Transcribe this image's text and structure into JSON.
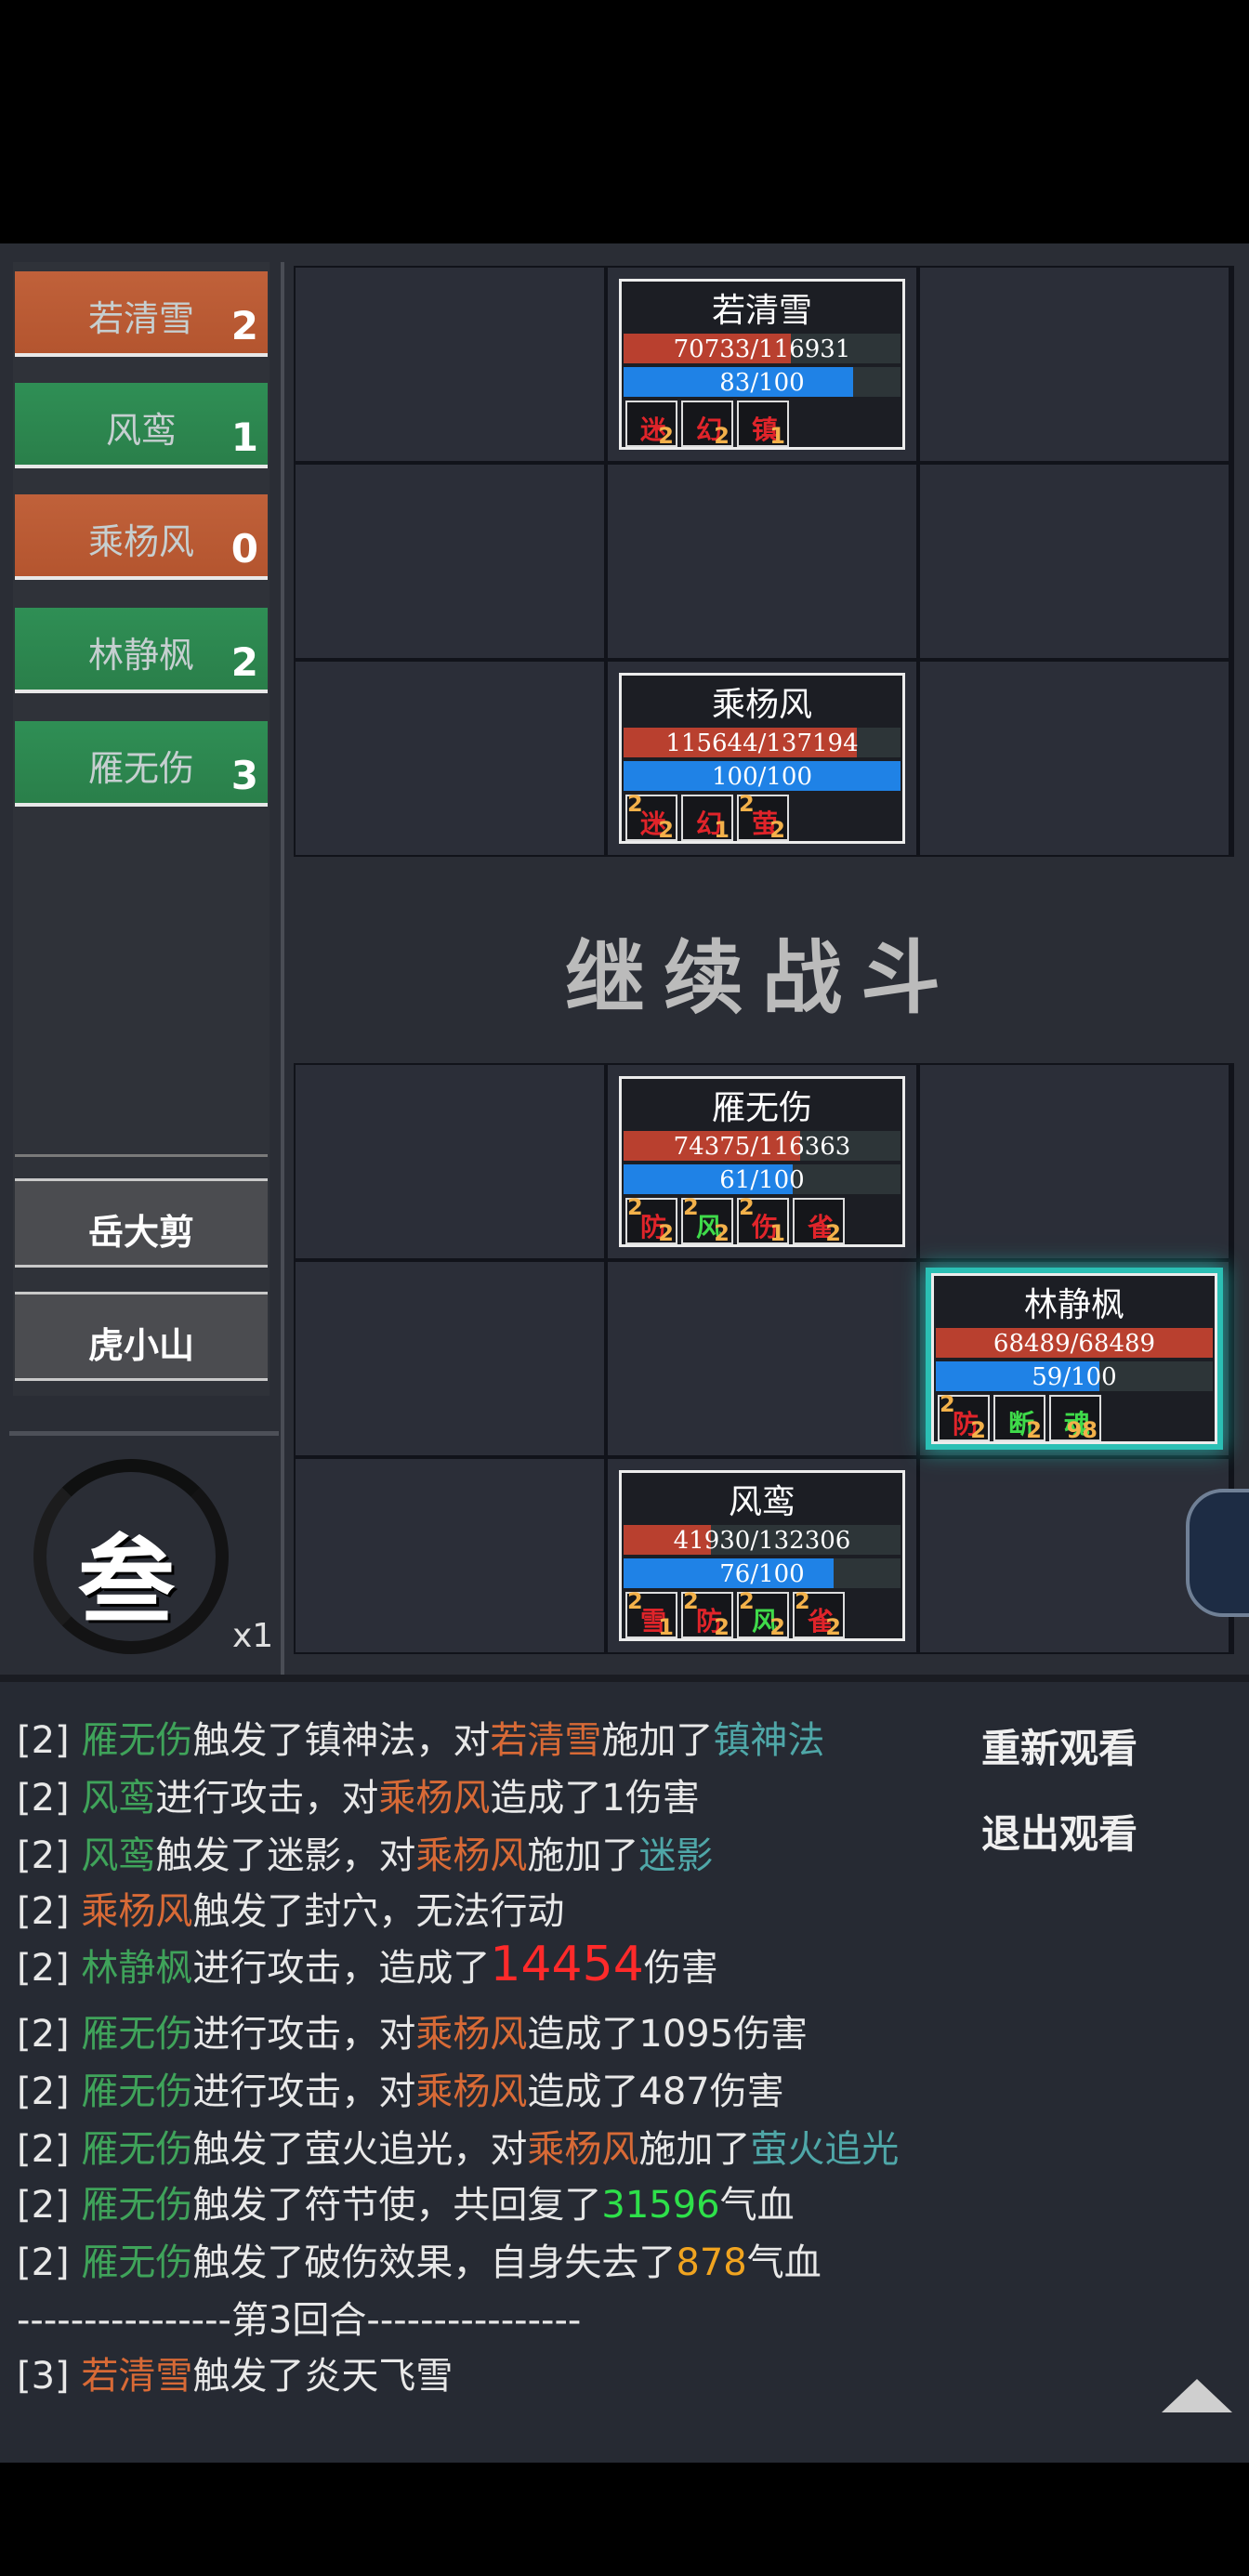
{
  "roster": [
    {
      "name": "若清雪",
      "count": "2",
      "color": "orange"
    },
    {
      "name": "风鸾",
      "count": "1",
      "color": "green"
    },
    {
      "name": "乘杨风",
      "count": "0",
      "color": "orange"
    },
    {
      "name": "林静枫",
      "count": "2",
      "color": "green"
    },
    {
      "name": "雁无伤",
      "count": "3",
      "color": "green"
    }
  ],
  "reserve": [
    "岳大剪",
    "虎小山"
  ],
  "round": {
    "char": "叁",
    "speed": "x1"
  },
  "continue_label": "继续战斗",
  "units": {
    "ruoqingxue": {
      "name": "若清雪",
      "hp": "70733/116931",
      "hp_ratio": 0.605,
      "mp": "83/100",
      "mp_ratio": 0.83,
      "buffs": [
        {
          "ch": "迷",
          "stack": "",
          "dur": "2"
        },
        {
          "ch": "幻",
          "stack": "",
          "dur": "2"
        },
        {
          "ch": "镇",
          "stack": "",
          "dur": "1"
        }
      ]
    },
    "chengyangfeng": {
      "name": "乘杨风",
      "hp": "115644/137194",
      "hp_ratio": 0.843,
      "mp": "100/100",
      "mp_ratio": 1.0,
      "buffs": [
        {
          "ch": "迷",
          "stack": "2",
          "dur": "2"
        },
        {
          "ch": "幻",
          "stack": "",
          "dur": "1"
        },
        {
          "ch": "萤",
          "stack": "2",
          "dur": "2"
        }
      ]
    },
    "yanwushang": {
      "name": "雁无伤",
      "hp": "74375/116363",
      "hp_ratio": 0.639,
      "mp": "61/100",
      "mp_ratio": 0.61,
      "buffs": [
        {
          "ch": "防",
          "stack": "2",
          "dur": "2"
        },
        {
          "ch": "风",
          "stack": "2",
          "dur": "2"
        },
        {
          "ch": "伤",
          "stack": "2",
          "dur": "1"
        },
        {
          "ch": "雀",
          "stack": "",
          "dur": "2"
        }
      ]
    },
    "linjingfeng": {
      "name": "林静枫",
      "hp": "68489/68489",
      "hp_ratio": 1.0,
      "mp": "59/100",
      "mp_ratio": 0.59,
      "buffs": [
        {
          "ch": "防",
          "stack": "2",
          "dur": "2"
        },
        {
          "ch": "断",
          "stack": "",
          "dur": "2"
        },
        {
          "ch": "魂",
          "stack": "",
          "dur": "98"
        }
      ]
    },
    "fengluan": {
      "name": "风鸾",
      "hp": "41930/132306",
      "hp_ratio": 0.317,
      "mp": "76/100",
      "mp_ratio": 0.76,
      "buffs": [
        {
          "ch": "雪",
          "stack": "2",
          "dur": "1"
        },
        {
          "ch": "防",
          "stack": "2",
          "dur": "2"
        },
        {
          "ch": "风",
          "stack": "2",
          "dur": "2"
        },
        {
          "ch": "雀",
          "stack": "2",
          "dur": "2"
        }
      ]
    }
  },
  "log_buttons": {
    "replay": "重新观看",
    "exit": "退出观看"
  },
  "log": [
    {
      "n": "[2] ",
      "a": "雁无伤",
      "b": "触发了镇神法，对",
      "c": "若清雪",
      "d": "施加了",
      "e": "镇神法"
    },
    {
      "n": "[2] ",
      "a": "风鸾",
      "b": "进行攻击，对",
      "c": "乘杨风",
      "d": "造成了1伤害"
    },
    {
      "n": "[2] ",
      "a": "风鸾",
      "b": "触发了迷影，对",
      "c": "乘杨风",
      "d": "施加了",
      "e": "迷影"
    },
    {
      "n": "[2] ",
      "a": "乘杨风",
      "b": "触发了封穴，无法行动"
    },
    {
      "n": "[2] ",
      "a": "林静枫",
      "b": "进行攻击，造成了",
      "big": "14454",
      "d": "伤害"
    },
    {
      "n": "[2] ",
      "a": "雁无伤",
      "b": "进行攻击，对",
      "c": "乘杨风",
      "d": "造成了1095伤害"
    },
    {
      "n": "[2] ",
      "a": "雁无伤",
      "b": "进行攻击，对",
      "c": "乘杨风",
      "d": "造成了487伤害"
    },
    {
      "n": "[2] ",
      "a": "雁无伤",
      "b": "触发了萤火追光，对",
      "c": "乘杨风",
      "d": "施加了",
      "e": "萤火追光"
    },
    {
      "n": "[2] ",
      "a": "雁无伤",
      "b": "触发了符节使，共回复了",
      "heal": "31596",
      "d": "气血"
    },
    {
      "n": "[2] ",
      "a": "雁无伤",
      "b": "触发了破伤效果，自身失去了",
      "loss": "878",
      "d": "气血"
    },
    {
      "sep": "----------------第3回合----------------"
    },
    {
      "n": "[3] ",
      "a": "若清雪",
      "b": "触发了炎天飞雪"
    }
  ]
}
